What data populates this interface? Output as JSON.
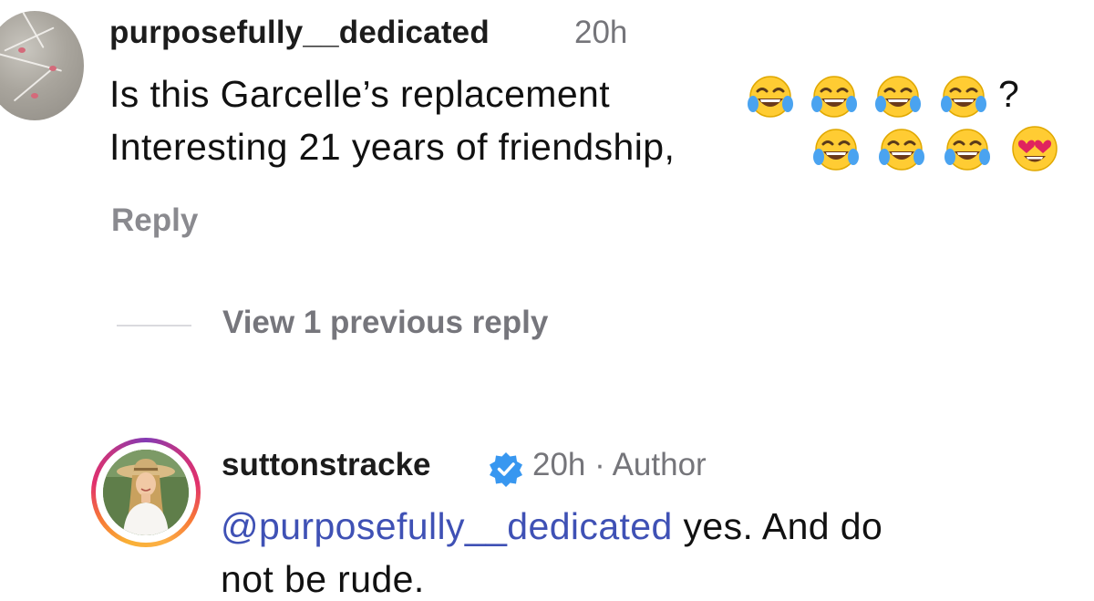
{
  "comment": {
    "username": "purposefully__dedicated",
    "time": "20h",
    "text_line1": "Is this  Garcelle’s replacement",
    "text_line2": "Interesting 21 years of friendship,",
    "line1_end": "?",
    "line1_emojis": [
      "tears-of-joy",
      "tears-of-joy",
      "tears-of-joy",
      "tears-of-joy"
    ],
    "line2_emojis": [
      "tears-of-joy",
      "tears-of-joy",
      "tears-of-joy",
      "heart-eyes"
    ],
    "reply_label": "Reply"
  },
  "thread": {
    "view_previous_label": "View 1 previous reply"
  },
  "author_reply": {
    "username": "suttonstracke",
    "verified": true,
    "meta": "20h · Author",
    "mention": "@purposefully__dedicated",
    "text_line1_rest": " yes. And do",
    "text_line2": "not be rude."
  },
  "colors": {
    "mention": "#3f51b5",
    "secondary_text": "#75757a",
    "verified_badge": "#3897f0"
  }
}
